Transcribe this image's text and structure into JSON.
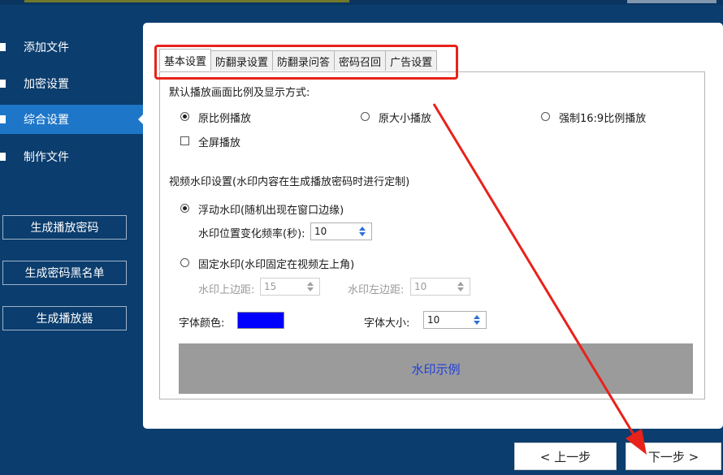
{
  "sidebar": {
    "nav": [
      {
        "label": "添加文件"
      },
      {
        "label": "加密设置"
      },
      {
        "label": "综合设置"
      },
      {
        "label": "制作文件"
      }
    ],
    "buttons": [
      {
        "label": "生成播放密码"
      },
      {
        "label": "生成密码黑名单"
      },
      {
        "label": "生成播放器"
      }
    ]
  },
  "tabs": [
    {
      "label": "基本设置"
    },
    {
      "label": "防翻录设置"
    },
    {
      "label": "防翻录问答"
    },
    {
      "label": "密码召回"
    },
    {
      "label": "广告设置"
    }
  ],
  "display": {
    "section_title": "默认播放画面比例及显示方式:",
    "opt_original_ratio": "原比例播放",
    "opt_original_size": "原大小播放",
    "opt_force_169": "强制16:9比例播放",
    "fullscreen": "全屏播放"
  },
  "watermark": {
    "section_title": "视频水印设置(水印内容在生成播放密码时进行定制)",
    "floating_label": "浮动水印(随机出现在窗口边缘)",
    "freq_label": "水印位置变化频率(秒):",
    "freq_value": "10",
    "fixed_label": "固定水印(水印固定在视频左上角)",
    "top_label": "水印上边距:",
    "top_value": "15",
    "left_label": "水印左边距:",
    "left_value": "10",
    "font_color_label": "字体颜色:",
    "font_color": "#0000ff",
    "font_size_label": "字体大小:",
    "font_size_value": "10",
    "preview_text": "水印示例"
  },
  "footer": {
    "prev": "< 上一步",
    "next": "下一步 >"
  },
  "colors": {
    "background": "#0b3d6e",
    "nav_active": "#1e76c9",
    "highlight": "#e8221b",
    "preview_bg": "#9b9b9b",
    "preview_text": "#1f3fd8"
  }
}
